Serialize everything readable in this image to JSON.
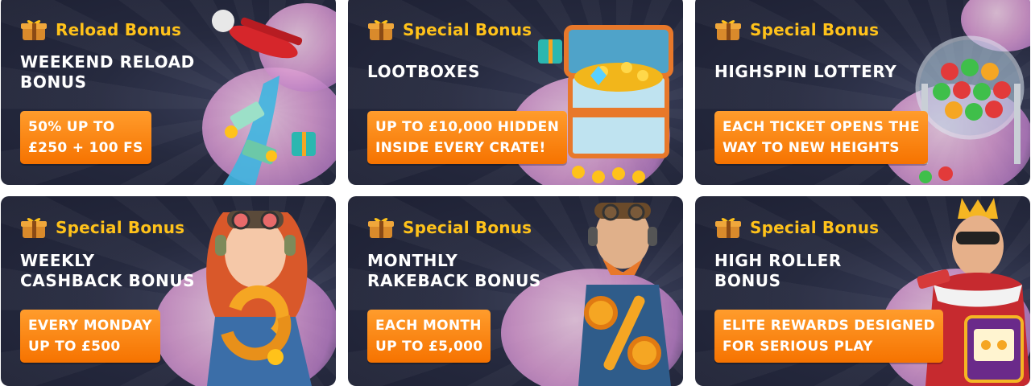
{
  "cards": [
    {
      "tag": "Reload Bonus",
      "title": "WEEKEND RELOAD\nBONUS",
      "cta": "50% UP TO\n£250 + 100 FS",
      "art": "airplane-and-money-icon"
    },
    {
      "tag": "Special Bonus",
      "title": "LOOTBOXES",
      "cta": "UP TO £10,000 HIDDEN\nINSIDE EVERY CRATE!",
      "art": "treasure-chest-icon"
    },
    {
      "tag": "Special Bonus",
      "title": "HIGHSPIN LOTTERY",
      "cta": "EACH TICKET OPENS THE\nWAY TO NEW HEIGHTS",
      "art": "lottery-drum-icon"
    },
    {
      "tag": "Special Bonus",
      "title": "WEEKLY\nCASHBACK BONUS",
      "cta": "EVERY MONDAY\nUP TO £500",
      "art": "pilot-girl-cashback-icon"
    },
    {
      "tag": "Special Bonus",
      "title": "MONTHLY\nRAKEBACK BONUS",
      "cta": "EACH MONTH\nUP TO £5,000",
      "art": "pilot-percent-icon"
    },
    {
      "tag": "Special Bonus",
      "title": "HIGH ROLLER\nBONUS",
      "cta": "ELITE REWARDS DESIGNED\nFOR SERIOUS PLAY",
      "art": "king-pilot-slot-icon"
    }
  ],
  "colors": {
    "tag": "#ffc21a",
    "cta_top": "#ff9c2c",
    "cta_bottom": "#f67300",
    "card_bg": "#262a3f"
  }
}
